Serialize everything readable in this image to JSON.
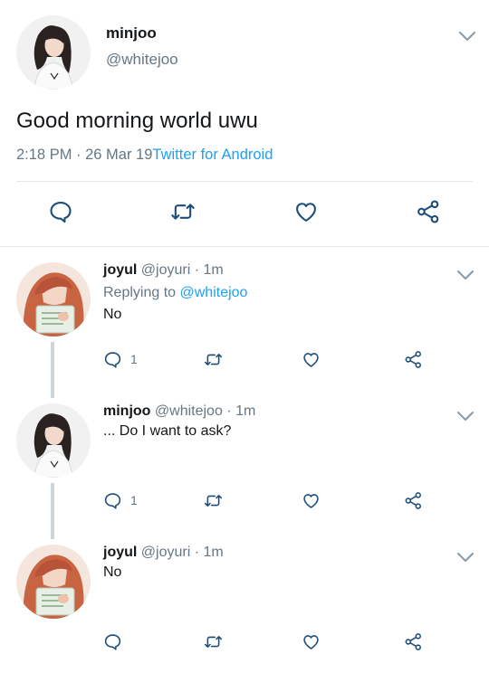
{
  "main_tweet": {
    "name": "minjoo",
    "handle": "@whitejoo",
    "text": "Good morning world uwu",
    "timestamp": "2:18 PM · 26 Mar 19",
    "source": "Twitter for Android",
    "avatar": "avatar-minjoo"
  },
  "replies": [
    {
      "name": "joyul",
      "handle": "@joyuri",
      "time": "· 1m",
      "replying_prefix": "Replying to",
      "replying_to": "@whitejoo",
      "text": "No",
      "reply_count": "1",
      "avatar": "avatar-joyul"
    },
    {
      "name": "minjoo",
      "handle": "@whitejoo",
      "time": "· 1m",
      "text": "... Do I want to ask?",
      "reply_count": "1",
      "avatar": "avatar-minjoo"
    },
    {
      "name": "joyul",
      "handle": "@joyuri",
      "time": "· 1m",
      "text": "No",
      "reply_count": "",
      "avatar": "avatar-joyul"
    }
  ],
  "colors": {
    "link": "#1da1f2",
    "secondary_text": "#657786",
    "divider": "#e1e8ed",
    "icon": "#1d4e7a"
  },
  "icons": [
    "reply-icon",
    "retweet-icon",
    "like-icon",
    "share-icon",
    "chevron-down-icon"
  ]
}
